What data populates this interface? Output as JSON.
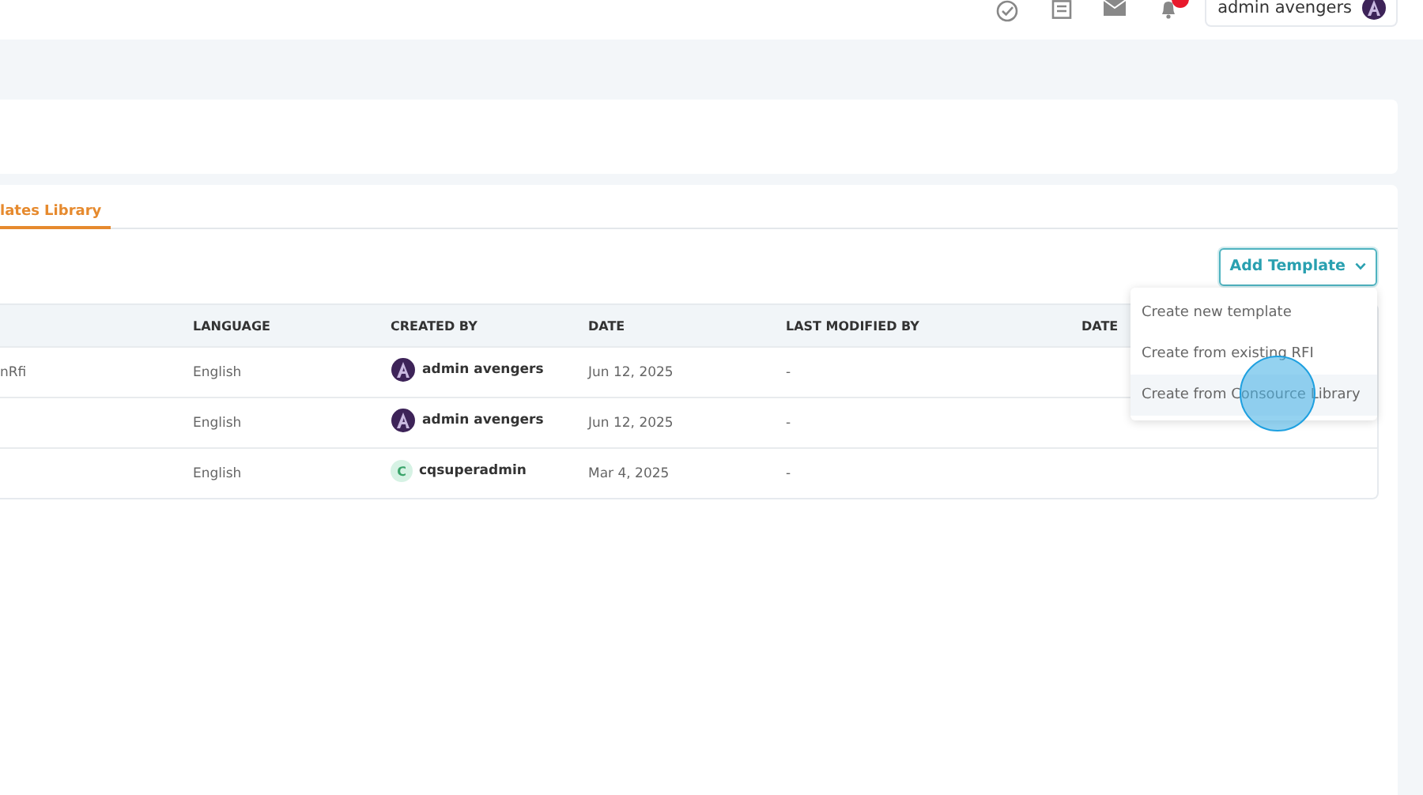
{
  "topbar": {
    "user": "admin avengers",
    "notification_badge": true
  },
  "tabs": [
    {
      "label": "lates Library",
      "selected": true
    }
  ],
  "add_button": {
    "label": "Add Template",
    "expanded": true
  },
  "menu": [
    {
      "label": "Create new template",
      "selected": false
    },
    {
      "label": "Create from existing RFI",
      "selected": false
    },
    {
      "label": "Create from Consource Library",
      "selected": true
    }
  ],
  "table": {
    "columns": [
      "LANGUAGE",
      "CREATED BY",
      "DATE",
      "LAST MODIFIED BY",
      "DATE"
    ],
    "rows": [
      {
        "name": "nRfi",
        "language": "English",
        "avatar": {
          "kind": "logo"
        },
        "created_by": "admin avengers",
        "date": "Jun 12, 2025",
        "last_modified_by": "-"
      },
      {
        "language": "English",
        "avatar": {
          "kind": "logo"
        },
        "created_by": "admin avengers",
        "date": "Jun 12, 2025",
        "last_modified_by": "-"
      },
      {
        "language": "English",
        "avatar": {
          "kind": "initial",
          "initial": "C"
        },
        "created_by": "cqsuperadmin",
        "date": "Mar 4, 2025",
        "last_modified_by": "-"
      }
    ]
  },
  "click_indicator": true
}
